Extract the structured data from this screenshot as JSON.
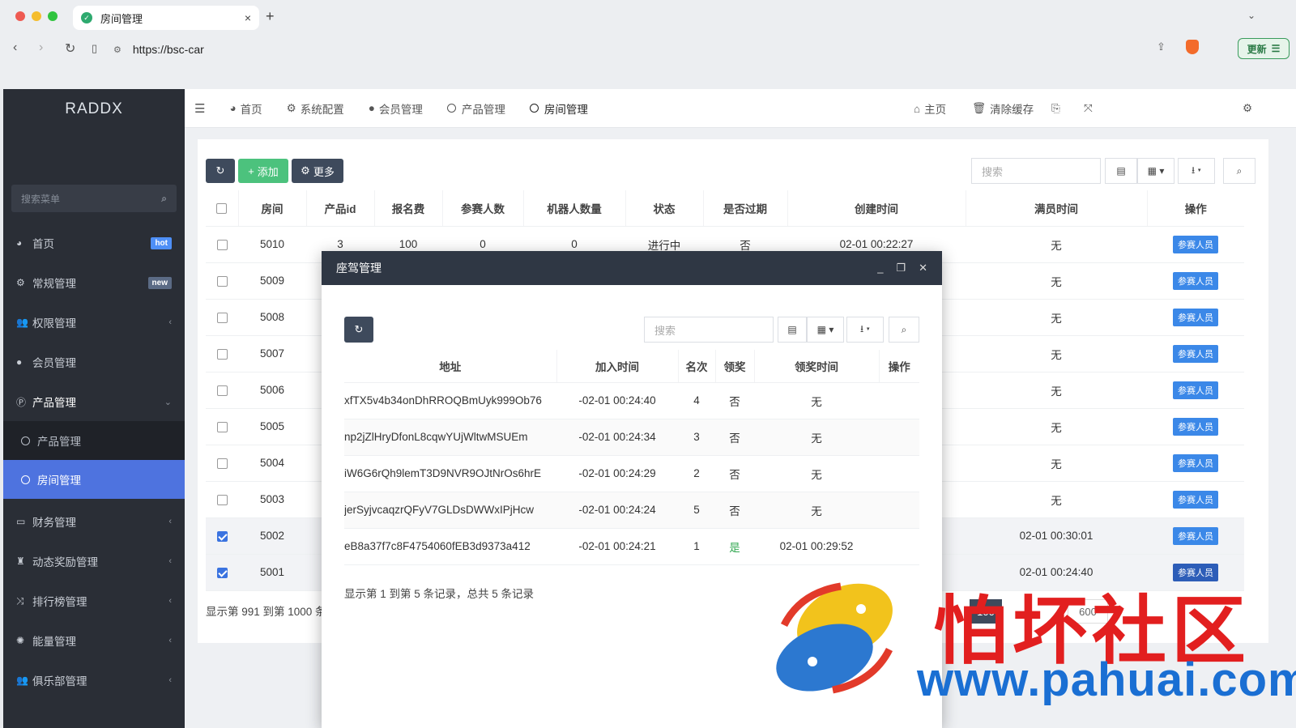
{
  "browser": {
    "tab_title": "房间管理",
    "tab_close": "×",
    "new_tab": "+",
    "url": "https://bsc-car",
    "update_label": "更新"
  },
  "sidebar": {
    "logo": "RADDX",
    "search_placeholder": "搜索菜单",
    "items": [
      {
        "label": "首页",
        "badge": "hot",
        "badge_color": "#4e8ff7"
      },
      {
        "label": "常规管理",
        "badge": "new",
        "badge_color": "#5b6b85"
      },
      {
        "label": "权限管理"
      },
      {
        "label": "会员管理"
      },
      {
        "label": "产品管理"
      },
      {
        "label": "财务管理"
      },
      {
        "label": "动态奖励管理"
      },
      {
        "label": "排行榜管理"
      },
      {
        "label": "能量管理"
      },
      {
        "label": "俱乐部管理"
      }
    ],
    "sub_items": [
      {
        "label": "产品管理"
      },
      {
        "label": "房间管理",
        "active": true
      }
    ]
  },
  "topnav": {
    "tabs": [
      "首页",
      "系统配置",
      "会员管理",
      "产品管理",
      "房间管理"
    ],
    "home": "主页",
    "clear_cache": "清除缓存"
  },
  "toolbar": {
    "add": "添加",
    "more": "更多",
    "search_placeholder": "搜索"
  },
  "main_table": {
    "headers": [
      "房间",
      "产品id",
      "报名费",
      "参赛人数",
      "机器人数量",
      "状态",
      "是否过期",
      "创建时间",
      "满员时间",
      "操作"
    ],
    "first_row": {
      "room": "5010",
      "product_id": "3",
      "fee": "100",
      "participants": "0",
      "robots": "0",
      "status": "进行中",
      "expired": "否",
      "created": "02-01 00:22:27",
      "full_time": "无"
    },
    "rooms": [
      "5010",
      "5009",
      "5008",
      "5007",
      "5006",
      "5005",
      "5004",
      "5003",
      "5002",
      "5001"
    ],
    "full_times": [
      "无",
      "无",
      "无",
      "无",
      "无",
      "无",
      "无",
      "无",
      "02-01 00:30:01",
      "02-01 00:24:40"
    ],
    "checked": [
      false,
      false,
      false,
      false,
      false,
      false,
      false,
      false,
      true,
      true
    ],
    "action_label": "参赛人员",
    "footer": "显示第 991 到第 1000 条",
    "page_size": "100",
    "page_num": "600"
  },
  "modal": {
    "title": "座驾管理",
    "search_placeholder": "搜索",
    "headers": [
      "地址",
      "加入时间",
      "名次",
      "领奖",
      "领奖时间",
      "操作"
    ],
    "rows": [
      {
        "address": "xfTX5v4b34onDhRROQBmUyk999Ob76",
        "joined": "-02-01 00:24:40",
        "rank": "4",
        "claimed": "否",
        "claim_time": "无"
      },
      {
        "address": "np2jZlHryDfonL8cqwYUjWltwMSUEm",
        "joined": "-02-01 00:24:34",
        "rank": "3",
        "claimed": "否",
        "claim_time": "无"
      },
      {
        "address": "iW6G6rQh9lemT3D9NVR9OJtNrOs6hrE",
        "joined": "-02-01 00:24:29",
        "rank": "2",
        "claimed": "否",
        "claim_time": "无"
      },
      {
        "address": "jerSyjvcaqzrQFyV7GLDsDWWxIPjHcw",
        "joined": "-02-01 00:24:24",
        "rank": "5",
        "claimed": "否",
        "claim_time": "无"
      },
      {
        "address": "eB8a37f7c8F4754060fEB3d9373a412",
        "joined": "-02-01 00:24:21",
        "rank": "1",
        "claimed": "是",
        "claim_time": "02-01 00:29:52"
      }
    ],
    "footer": "显示第 1 到第 5 条记录，总共 5 条记录"
  },
  "watermark": {
    "text": "怕坏社区",
    "url": "www.pahuai.com"
  }
}
